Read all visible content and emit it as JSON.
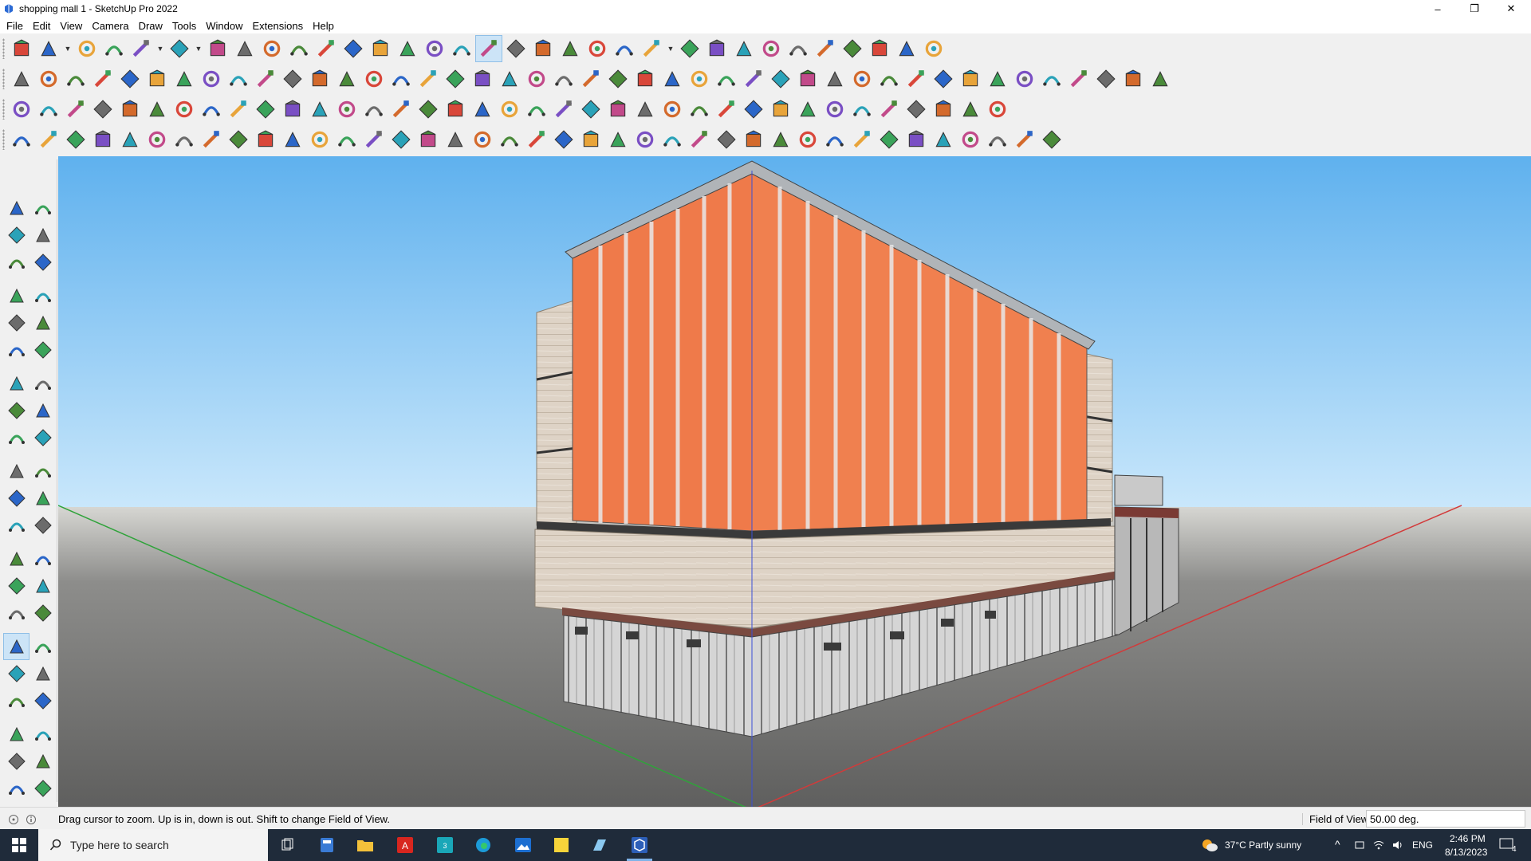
{
  "window": {
    "title": "shopping mall 1 - SketchUp Pro 2022",
    "minimize": "–",
    "restore": "❐",
    "close": "✕"
  },
  "menu": [
    "File",
    "Edit",
    "View",
    "Camera",
    "Draw",
    "Tools",
    "Window",
    "Extensions",
    "Help"
  ],
  "toolbar_rows": [
    [
      "zoom-extents-icon",
      "select-icon",
      "eraser-icon",
      "pencil-line-icon",
      "arc-icon",
      "rectangle-icon",
      "push-pull-icon",
      "follow-me-icon",
      "move-icon",
      "rotate-icon",
      "scale-icon",
      "tape-measure-icon",
      "text-icon",
      "paint-bucket-icon",
      "orbit-icon",
      "pan-icon",
      "zoom-icon",
      "zoom-window-icon",
      "section-plane-icon",
      "display-section-icon",
      "layers-icon",
      "style-icon",
      "account-icon",
      "add-location-icon",
      "terrain-icon",
      "photo-texture-icon",
      "upload-icon",
      "download-icon",
      "match-photo-icon",
      "model-info-icon",
      "undo-icon",
      "redo-icon",
      "trimble-icon"
    ],
    [
      "solid-union-icon",
      "solid-intersect-icon",
      "solid-subtract-icon",
      "sandbox-smoove-icon",
      "drape-icon",
      "stamp-icon",
      "flip-icon",
      "add-detail-icon",
      "outer-shell-icon",
      "split-icon",
      "trim-icon",
      "unwrap-icon",
      "green-box-icon",
      "green-plane-icon",
      "iso-view-icon",
      "top-view-icon",
      "front-view-icon",
      "right-view-icon",
      "back-view-icon",
      "left-view-icon",
      "bottom-view-icon",
      "measure-angle-icon",
      "protractor-icon",
      "ruler-icon",
      "rounded-rect-icon",
      "circle-icon",
      "polygon-icon",
      "ellipse-icon",
      "parallelogram-icon",
      "curve-icon",
      "bezier-icon",
      "spline-icon",
      "lathe-icon",
      "pipe-icon",
      "extrude-icon",
      "loft-icon",
      "shell-icon",
      "path-icon",
      "grid-icon",
      "surface-icon",
      "dome-icon",
      "terrain-mesh-icon",
      "roof-icon"
    ],
    [
      "blue-face-icon",
      "blue-plane-icon",
      "yellow-face-icon",
      "green-face-icon",
      "red-face-icon",
      "white-face-icon",
      "loop-icon",
      "red-square-icon",
      "list-icon",
      "flag-icon",
      "wood-block-icon",
      "chain-icon",
      "offset-icon",
      "dots-icon",
      "red-cross-icon",
      "green-cross-icon",
      "blue-x-icon",
      "cone-icon",
      "cone-alt-icon",
      "warning-icon",
      "hook-icon",
      "cut-icon",
      "cycle-icon",
      "snap-icon",
      "box-icon",
      "magnet-icon",
      "joint-icon",
      "connect-icon",
      "tag-icon",
      "beam-icon",
      "shelf-icon",
      "frame-icon",
      "grid-yellow-icon",
      "window-yellow-icon",
      "x-dots-icon",
      "arc-dots-icon",
      "component-icon"
    ],
    [
      "curve-tool-icon",
      "spline-tool-icon",
      "paint-tool-icon",
      "scissors-icon",
      "gear-tool-icon",
      "fold-icon",
      "bend-icon",
      "shape-icon",
      "brain-icon",
      "cone-tool-icon",
      "corner-icon",
      "corner-alt-icon",
      "line-tool-icon",
      "sweep-icon",
      "building-icon",
      "prism-icon",
      "comb-icon",
      "comb-alt-icon",
      "hand-icon",
      "leaf-icon",
      "arrow-tool-icon",
      "stack-icon",
      "feather-icon",
      "wind-icon",
      "wind-alt-icon",
      "wind-third-icon",
      "vehicle-icon",
      "stripes-icon",
      "panel-icon",
      "panel-alt-icon",
      "grid-dark-icon",
      "grid-hatch-icon",
      "fence-icon",
      "column-icon",
      "dome-tool-icon",
      "palm-icon",
      "fan-icon",
      "tree-icon",
      "pavilion-icon"
    ]
  ],
  "left_tools": [
    "select-icon",
    "orbit-icon",
    "paint-bucket-icon",
    "eraser-icon",
    "component-icon",
    "pencil-icon",
    "line-icon",
    "freehand-icon",
    "rectangle-icon",
    "rotated-rect-icon",
    "circle-icon",
    "polygon-icon",
    "arc-icon",
    "two-point-arc-icon",
    "three-point-arc-icon",
    "pie-icon",
    "move-icon",
    "push-pull-icon",
    "rotate-icon",
    "follow-me-icon",
    "scale-icon",
    "offset-icon",
    "tape-measure-icon",
    "dimension-icon",
    "protractor-icon",
    "text-icon",
    "axes-icon",
    "3d-text-icon",
    "orbit-tool-icon",
    "pan-tool-icon",
    "zoom-tool-icon",
    "zoom-window-tool-icon",
    "zoom-extents-tool-icon",
    "previous-view-icon",
    "position-camera-icon",
    "look-around-icon",
    "walk-icon",
    "section-tool-icon",
    "section-display-icon",
    "section-fill-icon",
    "layers-tool-icon",
    "styles-tool-icon"
  ],
  "status": {
    "hint": "Drag cursor to zoom.  Up is in, down is out. Shift to change Field of View.",
    "vcb_label": "Field of View",
    "vcb_value": "50.00 deg."
  },
  "taskbar": {
    "search_placeholder": "Type here to search",
    "weather": "37°C  Partly sunny",
    "lang": "ENG",
    "time": "2:46 PM",
    "date": "8/13/2023",
    "notif_count": "4"
  }
}
